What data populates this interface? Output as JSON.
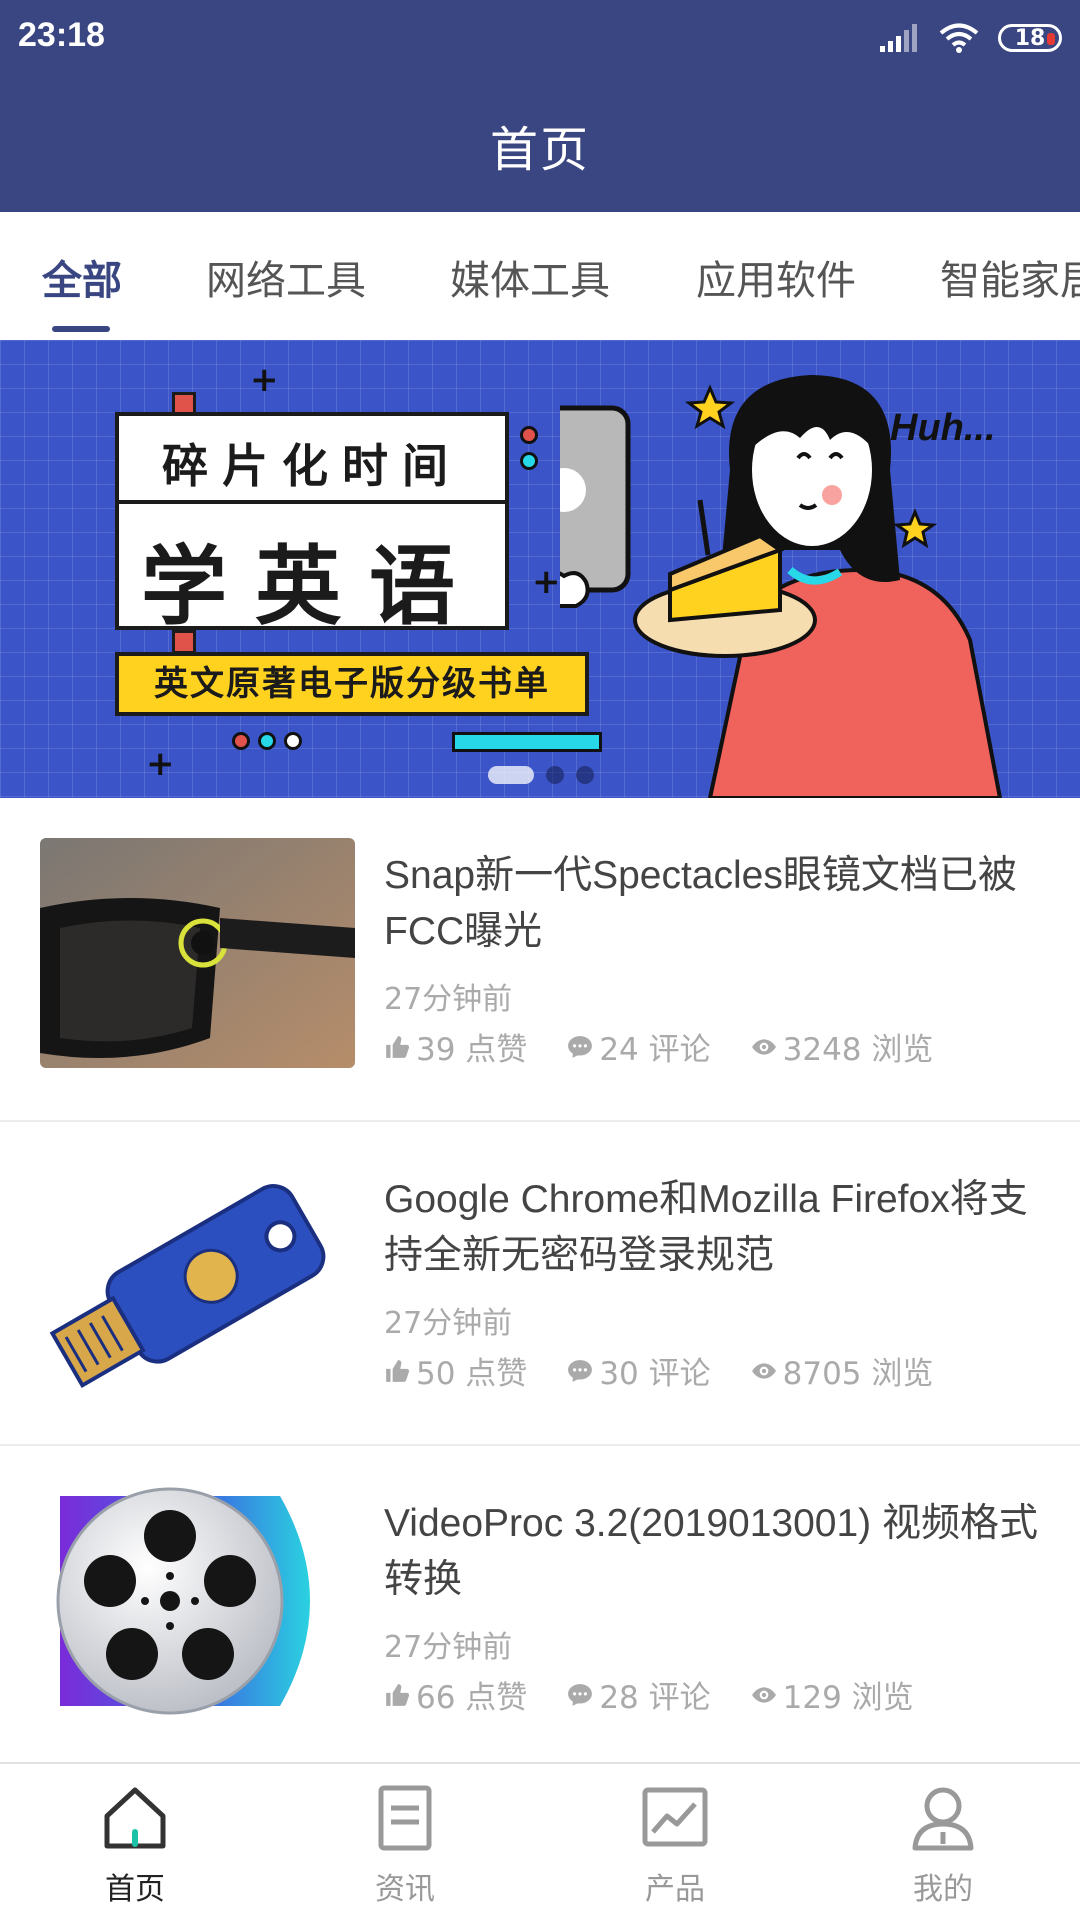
{
  "status_bar": {
    "time": "23:18",
    "battery": "18",
    "icons": [
      "signal-icon",
      "wifi-icon",
      "battery-icon"
    ]
  },
  "header": {
    "title": "首页"
  },
  "tabs": [
    {
      "label": "全部",
      "active": true
    },
    {
      "label": "网络工具",
      "active": false
    },
    {
      "label": "媒体工具",
      "active": false
    },
    {
      "label": "应用软件",
      "active": false
    },
    {
      "label": "智能家居",
      "active": false
    }
  ],
  "banner": {
    "line1": "碎片化时间",
    "line2": "学英语",
    "subtitle": "英文原著电子版分级书单",
    "bubble": "Huh...",
    "slides": 3,
    "active_slide": 1
  },
  "news": [
    {
      "title": "Snap新一代Spectacles眼镜文档已被FCC曝光",
      "time": "27分钟前",
      "likes": "39 点赞",
      "comments": "24 评论",
      "views": "3248 浏览",
      "thumb": "spectacles-glasses"
    },
    {
      "title": "Google Chrome和Mozilla Firefox将支持全新无密码登录规范",
      "time": "27分钟前",
      "likes": "50 点赞",
      "comments": "30 评论",
      "views": "8705 浏览",
      "thumb": "security-key"
    },
    {
      "title": "VideoProc 3.2(2019013001) 视频格式转换",
      "time": "27分钟前",
      "likes": "66 点赞",
      "comments": "28 评论",
      "views": "129 浏览",
      "thumb": "film-reel"
    }
  ],
  "bottom_nav": [
    {
      "label": "首页",
      "icon": "home-icon",
      "active": true
    },
    {
      "label": "资讯",
      "icon": "document-icon",
      "active": false
    },
    {
      "label": "产品",
      "icon": "chart-image-icon",
      "active": false
    },
    {
      "label": "我的",
      "icon": "user-icon",
      "active": false
    }
  ],
  "colors": {
    "primary": "#3a4681",
    "banner_bg": "#3b55c9",
    "accent_yellow": "#ffd21f",
    "accent_cyan": "#27d8e8"
  }
}
